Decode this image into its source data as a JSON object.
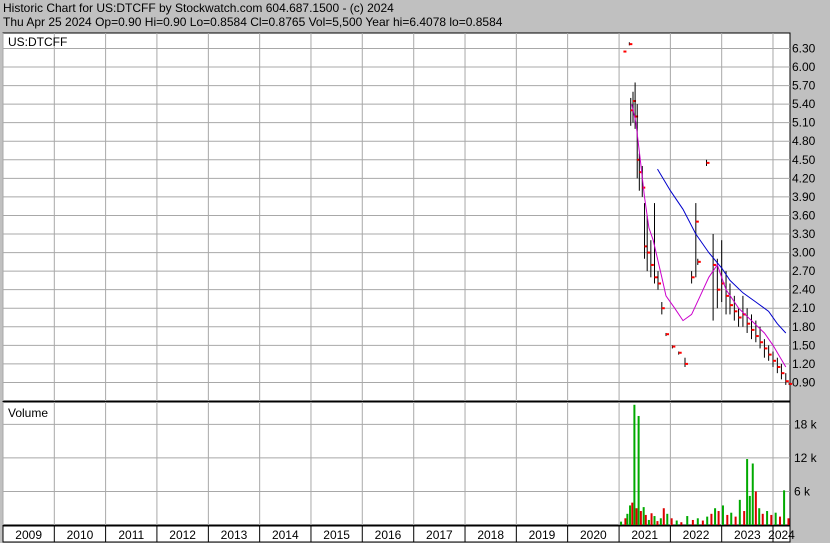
{
  "header": {
    "line1": "Historic Chart for US:DTCFF by Stockwatch.com 604.687.1500 - (c) 2024",
    "line2": "Thu Apr 25 2024   Op=0.90   Hi=0.90   Lo=0.8584   Cl=0.8765   Vol=5,500   Year hi=6.4078   lo=0.8584"
  },
  "colors": {
    "background": "#c0c0c0",
    "plot": "#ffffff",
    "grid": "#a8a8a8",
    "price_bar": "#000000",
    "close_tick": "#ff0000",
    "ma_long": "#0000cc",
    "ma_short": "#cc00cc",
    "volume_up": "#00aa00",
    "volume_down": "#dd0000"
  },
  "chart_data": [
    {
      "type": "line",
      "title": "US:DTCFF",
      "x_type": "date",
      "xlim": [
        "2009-01-01",
        "2024-05-01"
      ],
      "ylim": [
        0.6,
        6.55
      ],
      "y_ticks": [
        "6.30",
        "6.00",
        "5.70",
        "5.40",
        "5.10",
        "4.80",
        "4.50",
        "4.20",
        "3.90",
        "3.60",
        "3.30",
        "3.00",
        "2.70",
        "2.40",
        "2.10",
        "1.80",
        "1.50",
        "1.20",
        "0.90"
      ],
      "y_tick_values": [
        6.3,
        6.0,
        5.7,
        5.4,
        5.1,
        4.8,
        4.5,
        4.2,
        3.9,
        3.6,
        3.3,
        3.0,
        2.7,
        2.4,
        2.1,
        1.8,
        1.5,
        1.2,
        0.9
      ],
      "x_ticks": [
        "2009",
        "2010",
        "2011",
        "2012",
        "2013",
        "2014",
        "2015",
        "2016",
        "2017",
        "2018",
        "2019",
        "2020",
        "2021",
        "2022",
        "2023",
        "2024"
      ],
      "grid": true,
      "series": [
        {
          "kind": "price_bars",
          "points": [
            {
              "x": "2021-02-01",
              "h": 6.25,
              "l": 6.25,
              "c": 6.25
            },
            {
              "x": "2021-03-15",
              "h": 6.4,
              "l": 6.35,
              "c": 6.37
            },
            {
              "x": "2021-03-25",
              "h": 5.5,
              "l": 5.05,
              "c": 5.3
            },
            {
              "x": "2021-04-10",
              "h": 5.6,
              "l": 5.1,
              "c": 5.45
            },
            {
              "x": "2021-04-25",
              "h": 5.75,
              "l": 5.0,
              "c": 5.2
            },
            {
              "x": "2021-05-10",
              "h": 5.4,
              "l": 4.2,
              "c": 4.5
            },
            {
              "x": "2021-05-25",
              "h": 4.6,
              "l": 4.0,
              "c": 4.3
            },
            {
              "x": "2021-06-15",
              "h": 4.4,
              "l": 3.9,
              "c": 4.05
            },
            {
              "x": "2021-07-01",
              "h": 3.8,
              "l": 2.9,
              "c": 3.1
            },
            {
              "x": "2021-07-20",
              "h": 3.6,
              "l": 2.7,
              "c": 3.0
            },
            {
              "x": "2021-08-15",
              "h": 3.2,
              "l": 2.6,
              "c": 2.8
            },
            {
              "x": "2021-09-10",
              "h": 3.8,
              "l": 2.5,
              "c": 2.6
            },
            {
              "x": "2021-10-05",
              "h": 2.7,
              "l": 2.4,
              "c": 2.5
            },
            {
              "x": "2021-11-01",
              "h": 2.2,
              "l": 2.0,
              "c": 2.1
            },
            {
              "x": "2021-12-01",
              "h": 1.7,
              "l": 1.65,
              "c": 1.68
            },
            {
              "x": "2022-01-15",
              "h": 1.5,
              "l": 1.45,
              "c": 1.48
            },
            {
              "x": "2022-03-01",
              "h": 1.4,
              "l": 1.35,
              "c": 1.38
            },
            {
              "x": "2022-04-15",
              "h": 1.3,
              "l": 1.15,
              "c": 1.2
            },
            {
              "x": "2022-06-01",
              "h": 2.7,
              "l": 2.5,
              "c": 2.6
            },
            {
              "x": "2022-07-01",
              "h": 3.8,
              "l": 2.6,
              "c": 3.5
            },
            {
              "x": "2022-07-15",
              "h": 2.9,
              "l": 2.8,
              "c": 2.85
            },
            {
              "x": "2022-09-15",
              "h": 4.5,
              "l": 4.4,
              "c": 4.45
            },
            {
              "x": "2022-11-01",
              "h": 3.3,
              "l": 1.9,
              "c": 2.8
            },
            {
              "x": "2022-12-01",
              "h": 2.9,
              "l": 2.1,
              "c": 2.4
            },
            {
              "x": "2023-01-01",
              "h": 3.2,
              "l": 2.2,
              "c": 2.5
            },
            {
              "x": "2023-02-01",
              "h": 2.7,
              "l": 2.0,
              "c": 2.3
            },
            {
              "x": "2023-03-01",
              "h": 2.5,
              "l": 2.0,
              "c": 2.15
            },
            {
              "x": "2023-04-01",
              "h": 2.3,
              "l": 1.9,
              "c": 2.05
            },
            {
              "x": "2023-05-01",
              "h": 2.1,
              "l": 1.8,
              "c": 1.95
            },
            {
              "x": "2023-06-01",
              "h": 2.3,
              "l": 1.8,
              "c": 2.0
            },
            {
              "x": "2023-07-01",
              "h": 2.1,
              "l": 1.7,
              "c": 1.85
            },
            {
              "x": "2023-08-01",
              "h": 2.0,
              "l": 1.6,
              "c": 1.75
            },
            {
              "x": "2023-09-01",
              "h": 1.9,
              "l": 1.55,
              "c": 1.65
            },
            {
              "x": "2023-10-01",
              "h": 1.8,
              "l": 1.45,
              "c": 1.55
            },
            {
              "x": "2023-11-01",
              "h": 1.6,
              "l": 1.3,
              "c": 1.45
            },
            {
              "x": "2023-12-01",
              "h": 1.5,
              "l": 1.25,
              "c": 1.35
            },
            {
              "x": "2024-01-01",
              "h": 1.4,
              "l": 1.15,
              "c": 1.25
            },
            {
              "x": "2024-02-01",
              "h": 1.3,
              "l": 1.05,
              "c": 1.15
            },
            {
              "x": "2024-03-01",
              "h": 1.2,
              "l": 0.95,
              "c": 1.05
            },
            {
              "x": "2024-04-01",
              "h": 1.05,
              "l": 0.86,
              "c": 0.92
            },
            {
              "x": "2024-04-25",
              "h": 0.9,
              "l": 0.8584,
              "c": 0.8765
            }
          ]
        },
        {
          "kind": "ma_short",
          "points": [
            {
              "x": "2021-04-01",
              "y": 5.4
            },
            {
              "x": "2021-05-01",
              "y": 5.1
            },
            {
              "x": "2021-06-01",
              "y": 4.5
            },
            {
              "x": "2021-07-01",
              "y": 3.9
            },
            {
              "x": "2021-08-01",
              "y": 3.4
            },
            {
              "x": "2021-09-01",
              "y": 3.2
            },
            {
              "x": "2021-10-01",
              "y": 2.9
            },
            {
              "x": "2021-11-01",
              "y": 2.6
            },
            {
              "x": "2021-12-01",
              "y": 2.3
            },
            {
              "x": "2022-02-01",
              "y": 2.1
            },
            {
              "x": "2022-04-01",
              "y": 1.9
            },
            {
              "x": "2022-06-01",
              "y": 2.0
            },
            {
              "x": "2022-08-01",
              "y": 2.3
            },
            {
              "x": "2022-10-01",
              "y": 2.6
            },
            {
              "x": "2022-12-01",
              "y": 2.8
            },
            {
              "x": "2023-02-01",
              "y": 2.4
            },
            {
              "x": "2023-05-01",
              "y": 2.1
            },
            {
              "x": "2023-08-01",
              "y": 1.9
            },
            {
              "x": "2023-11-01",
              "y": 1.7
            },
            {
              "x": "2024-01-01",
              "y": 1.5
            },
            {
              "x": "2024-04-01",
              "y": 1.15
            }
          ]
        },
        {
          "kind": "ma_long",
          "points": [
            {
              "x": "2021-10-01",
              "y": 4.35
            },
            {
              "x": "2022-01-01",
              "y": 4.0
            },
            {
              "x": "2022-04-01",
              "y": 3.7
            },
            {
              "x": "2022-07-01",
              "y": 3.3
            },
            {
              "x": "2022-10-01",
              "y": 3.0
            },
            {
              "x": "2023-01-01",
              "y": 2.75
            },
            {
              "x": "2023-03-01",
              "y": 2.55
            },
            {
              "x": "2023-06-01",
              "y": 2.35
            },
            {
              "x": "2023-09-01",
              "y": 2.2
            },
            {
              "x": "2023-12-01",
              "y": 2.05
            },
            {
              "x": "2024-02-01",
              "y": 1.85
            },
            {
              "x": "2024-04-01",
              "y": 1.7
            }
          ]
        }
      ]
    },
    {
      "type": "bar",
      "title": "Volume",
      "x_type": "date",
      "xlim": [
        "2009-01-01",
        "2024-05-01"
      ],
      "ylim": [
        0,
        22000
      ],
      "y_ticks": [
        "18 k",
        "12 k",
        "6 k"
      ],
      "y_tick_values": [
        18000,
        12000,
        6000
      ],
      "grid": true,
      "bars": [
        {
          "x": "2021-01-15",
          "v": 600,
          "up": true
        },
        {
          "x": "2021-02-15",
          "v": 1200,
          "up": false
        },
        {
          "x": "2021-03-01",
          "v": 2000,
          "up": true
        },
        {
          "x": "2021-03-20",
          "v": 3500,
          "up": true
        },
        {
          "x": "2021-04-05",
          "v": 4000,
          "up": false
        },
        {
          "x": "2021-04-20",
          "v": 21500,
          "up": true
        },
        {
          "x": "2021-05-05",
          "v": 3000,
          "up": false
        },
        {
          "x": "2021-05-20",
          "v": 19500,
          "up": true
        },
        {
          "x": "2021-06-05",
          "v": 2500,
          "up": false
        },
        {
          "x": "2021-06-25",
          "v": 3200,
          "up": true
        },
        {
          "x": "2021-07-10",
          "v": 1800,
          "up": false
        },
        {
          "x": "2021-08-01",
          "v": 900,
          "up": true
        },
        {
          "x": "2021-08-20",
          "v": 2100,
          "up": false
        },
        {
          "x": "2021-09-10",
          "v": 1600,
          "up": true
        },
        {
          "x": "2021-10-01",
          "v": 700,
          "up": false
        },
        {
          "x": "2021-10-25",
          "v": 1200,
          "up": true
        },
        {
          "x": "2021-11-15",
          "v": 3000,
          "up": false
        },
        {
          "x": "2021-12-10",
          "v": 2000,
          "up": true
        },
        {
          "x": "2022-01-10",
          "v": 1200,
          "up": false
        },
        {
          "x": "2022-02-15",
          "v": 800,
          "up": true
        },
        {
          "x": "2022-03-20",
          "v": 500,
          "up": false
        },
        {
          "x": "2022-05-01",
          "v": 1600,
          "up": true
        },
        {
          "x": "2022-06-10",
          "v": 900,
          "up": false
        },
        {
          "x": "2022-07-15",
          "v": 1200,
          "up": true
        },
        {
          "x": "2022-08-20",
          "v": 800,
          "up": false
        },
        {
          "x": "2022-09-20",
          "v": 1500,
          "up": true
        },
        {
          "x": "2022-10-20",
          "v": 2000,
          "up": false
        },
        {
          "x": "2022-11-15",
          "v": 3000,
          "up": true
        },
        {
          "x": "2022-12-10",
          "v": 2500,
          "up": false
        },
        {
          "x": "2023-01-10",
          "v": 3500,
          "up": true
        },
        {
          "x": "2023-02-10",
          "v": 1800,
          "up": false
        },
        {
          "x": "2023-03-10",
          "v": 2200,
          "up": true
        },
        {
          "x": "2023-04-10",
          "v": 1500,
          "up": false
        },
        {
          "x": "2023-05-10",
          "v": 4500,
          "up": true
        },
        {
          "x": "2023-06-10",
          "v": 2500,
          "up": false
        },
        {
          "x": "2023-07-01",
          "v": 11800,
          "up": true
        },
        {
          "x": "2023-07-20",
          "v": 5200,
          "up": true
        },
        {
          "x": "2023-08-10",
          "v": 11000,
          "up": true
        },
        {
          "x": "2023-09-01",
          "v": 6000,
          "up": false
        },
        {
          "x": "2023-09-25",
          "v": 3000,
          "up": true
        },
        {
          "x": "2023-10-20",
          "v": 2000,
          "up": false
        },
        {
          "x": "2023-11-20",
          "v": 2500,
          "up": true
        },
        {
          "x": "2023-12-20",
          "v": 1800,
          "up": false
        },
        {
          "x": "2024-01-20",
          "v": 2200,
          "up": true
        },
        {
          "x": "2024-02-20",
          "v": 1500,
          "up": false
        },
        {
          "x": "2024-03-20",
          "v": 6200,
          "up": true
        },
        {
          "x": "2024-04-20",
          "v": 1200,
          "up": false
        }
      ]
    }
  ]
}
